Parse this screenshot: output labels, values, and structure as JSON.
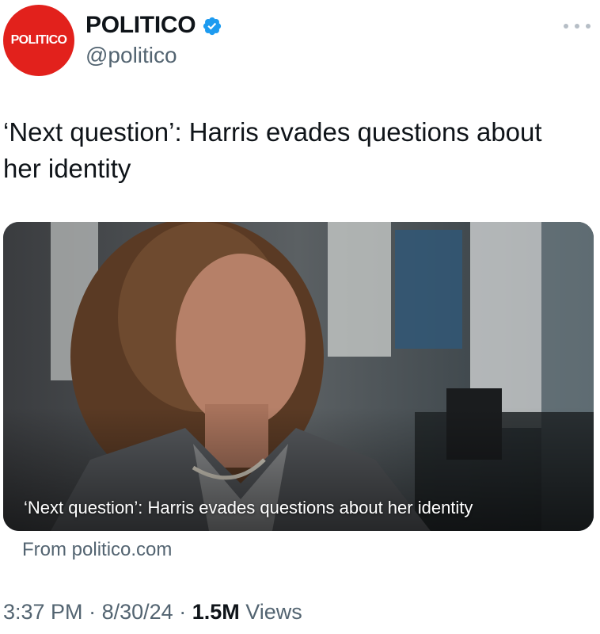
{
  "author": {
    "avatar_text": "POLITICO",
    "display_name": "POLITICO",
    "handle": "@politico",
    "verified": true,
    "avatar_color": "#e2211c",
    "verified_color": "#1d9bf0"
  },
  "tweet": {
    "text": "‘Next question’: Harris evades questions about her identity"
  },
  "card": {
    "headline": "‘Next question’: Harris evades questions about her identity",
    "source": "From politico.com",
    "image_icon": "video-thumbnail"
  },
  "meta": {
    "time": "3:37 PM",
    "date": "8/30/24",
    "views_count": "1.5M",
    "views_label": "Views",
    "separator": "·"
  },
  "actions": {
    "more_icon": "more-icon"
  }
}
